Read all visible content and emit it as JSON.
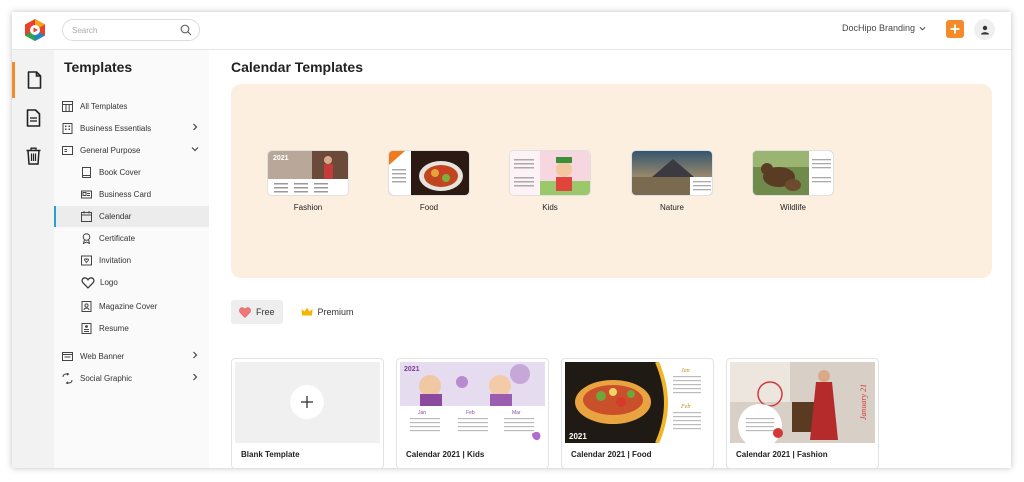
{
  "header": {
    "search_placeholder": "Search",
    "brand_label": "DocHipo Branding",
    "accent_color": "#f48a2a"
  },
  "rail": {
    "icons": [
      "document-icon",
      "file-text-icon",
      "trash-icon"
    ]
  },
  "sidebar": {
    "title": "Templates",
    "items": [
      {
        "label": "All Templates",
        "icon": "grid-icon"
      },
      {
        "label": "Business Essentials",
        "icon": "building-icon",
        "chevron": "right"
      },
      {
        "label": "General Purpose",
        "icon": "card-icon",
        "chevron": "down"
      },
      {
        "label": "Book Cover",
        "icon": "book-icon"
      },
      {
        "label": "Business Card",
        "icon": "id-card-icon"
      },
      {
        "label": "Calendar",
        "icon": "calendar-icon",
        "active": true
      },
      {
        "label": "Certificate",
        "icon": "award-icon"
      },
      {
        "label": "Invitation",
        "icon": "envelope-icon"
      },
      {
        "label": "Logo",
        "icon": "heart-outline-icon"
      },
      {
        "label": "Magazine Cover",
        "icon": "magazine-icon"
      },
      {
        "label": "Resume",
        "icon": "resume-icon"
      },
      {
        "label": "Web Banner",
        "icon": "web-icon",
        "chevron": "right"
      },
      {
        "label": "Social Graphic",
        "icon": "share-icon",
        "chevron": "right"
      }
    ]
  },
  "main": {
    "title": "Calendar Templates",
    "categories": [
      {
        "label": "Fashion",
        "badge": "2021"
      },
      {
        "label": "Food"
      },
      {
        "label": "Kids"
      },
      {
        "label": "Nature"
      },
      {
        "label": "Wildlife"
      }
    ],
    "filters": [
      {
        "label": "Free",
        "icon": "heart-icon",
        "selected": true
      },
      {
        "label": "Premium",
        "icon": "crown-icon",
        "selected": false
      }
    ],
    "cards": [
      {
        "label": "Blank Template"
      },
      {
        "label": "Calendar 2021 | Kids",
        "overlay": "2021",
        "months": [
          "Jan",
          "Feb",
          "Mar"
        ]
      },
      {
        "label": "Calendar 2021 | Food",
        "overlay": "2021",
        "months": [
          "Jan",
          "Feb"
        ]
      },
      {
        "label": "Calendar 2021 | Fashion",
        "overlay": "January 21"
      }
    ]
  }
}
